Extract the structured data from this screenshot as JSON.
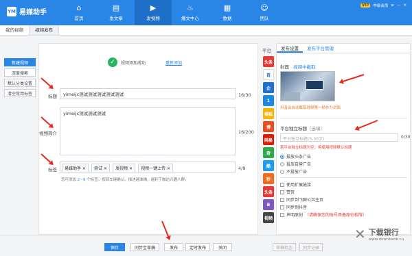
{
  "app": {
    "logo_mark": "YM",
    "title": "易媒助手"
  },
  "nav": [
    {
      "icon": "home",
      "label": "首页"
    },
    {
      "icon": "doc",
      "label": "发文章"
    },
    {
      "icon": "play",
      "label": "发视频"
    },
    {
      "icon": "fire",
      "label": "爆文中心"
    },
    {
      "icon": "chart",
      "label": "数据"
    },
    {
      "icon": "team",
      "label": "团队"
    }
  ],
  "user": {
    "vip": "VIP",
    "label": "中级会员"
  },
  "tabs": [
    "我的视频",
    "视频发布"
  ],
  "sidebar": [
    "新建视频",
    "深度搜索",
    "默认分类设置",
    "清空常用标签"
  ],
  "success": {
    "message": "视频添加成功",
    "action": "重新添加"
  },
  "form": {
    "title_label": "标题",
    "title_value": "yimeijc测试测试测试测试测试",
    "title_count": "16/30",
    "intro_label": "视频简介",
    "intro_value": "yimeijc测试测试测试",
    "intro_count": "16/200",
    "tags_label": "标签",
    "tags": [
      "易媒助手",
      "测试",
      "发视频",
      "视频一键上传"
    ],
    "tags_count": "4/9",
    "tags_hint_pre": "您可添加",
    "tags_hint_range": "2~9",
    "tags_hint_post": "个标签，按回车键确认。描述越准确，越利于触达兴趣人群。"
  },
  "platforms": {
    "title": "平台",
    "items": [
      {
        "name": "头条",
        "color": "#e53935",
        "label": "头条"
      },
      {
        "name": "百家",
        "color": "#ffffff",
        "label": "百"
      },
      {
        "name": "企鹅",
        "color": "#1f6fd1",
        "label": "企"
      },
      {
        "name": "一点",
        "color": "#1e88e5",
        "label": "1"
      },
      {
        "name": "搜狐",
        "color": "#f4b400",
        "label": "搜狐"
      },
      {
        "name": "微博",
        "color": "#e84e1b",
        "label": "博"
      },
      {
        "name": "网易",
        "color": "#d81e06",
        "label": "网易"
      },
      {
        "name": "爱奇艺",
        "color": "#2eaa4a",
        "label": "奇"
      },
      {
        "name": "优酷",
        "color": "#1e9cf0",
        "label": "酷"
      },
      {
        "name": "秒拍",
        "color": "#f46b1c",
        "label": "秒"
      },
      {
        "name": "头条2",
        "color": "#e53935",
        "label": "头条"
      },
      {
        "name": "B站",
        "color": "#7e57c2",
        "label": "B"
      },
      {
        "name": "其他",
        "color": "#444444",
        "label": "视频"
      }
    ]
  },
  "right": {
    "tabs": [
      "发布设置",
      "发布平台管理"
    ],
    "cover_label": "封面",
    "cover_action": "视频中截取",
    "cover_note": "抖音会自动截取视频第一帧作为封面",
    "title_section": "平台独立标题",
    "title_section_sub": "（选填）",
    "title_placeholder": "平台独立标题(5-30字)",
    "title_count": "0/30",
    "title_note": "若平台独立标题为空，将使用视频默认标题",
    "ads": [
      "投放头条广告",
      "投放自营广告",
      "不投放广告"
    ],
    "checks": [
      "使用扩展链接",
      "赞赏",
      "同步到飞聊公共主页",
      "同步到抖音",
      "声明原创"
    ],
    "original_note": "（请确保您的账号具备原创权限）"
  },
  "buttons": {
    "save": "保存",
    "sync": "同步至草稿",
    "publish": "发布",
    "timed": "定时发布",
    "close": "关闭",
    "r1": "草稿状态",
    "r2": "同步记录"
  },
  "watermark": {
    "big": "下载银行",
    "small": "www.downbank.cn"
  }
}
